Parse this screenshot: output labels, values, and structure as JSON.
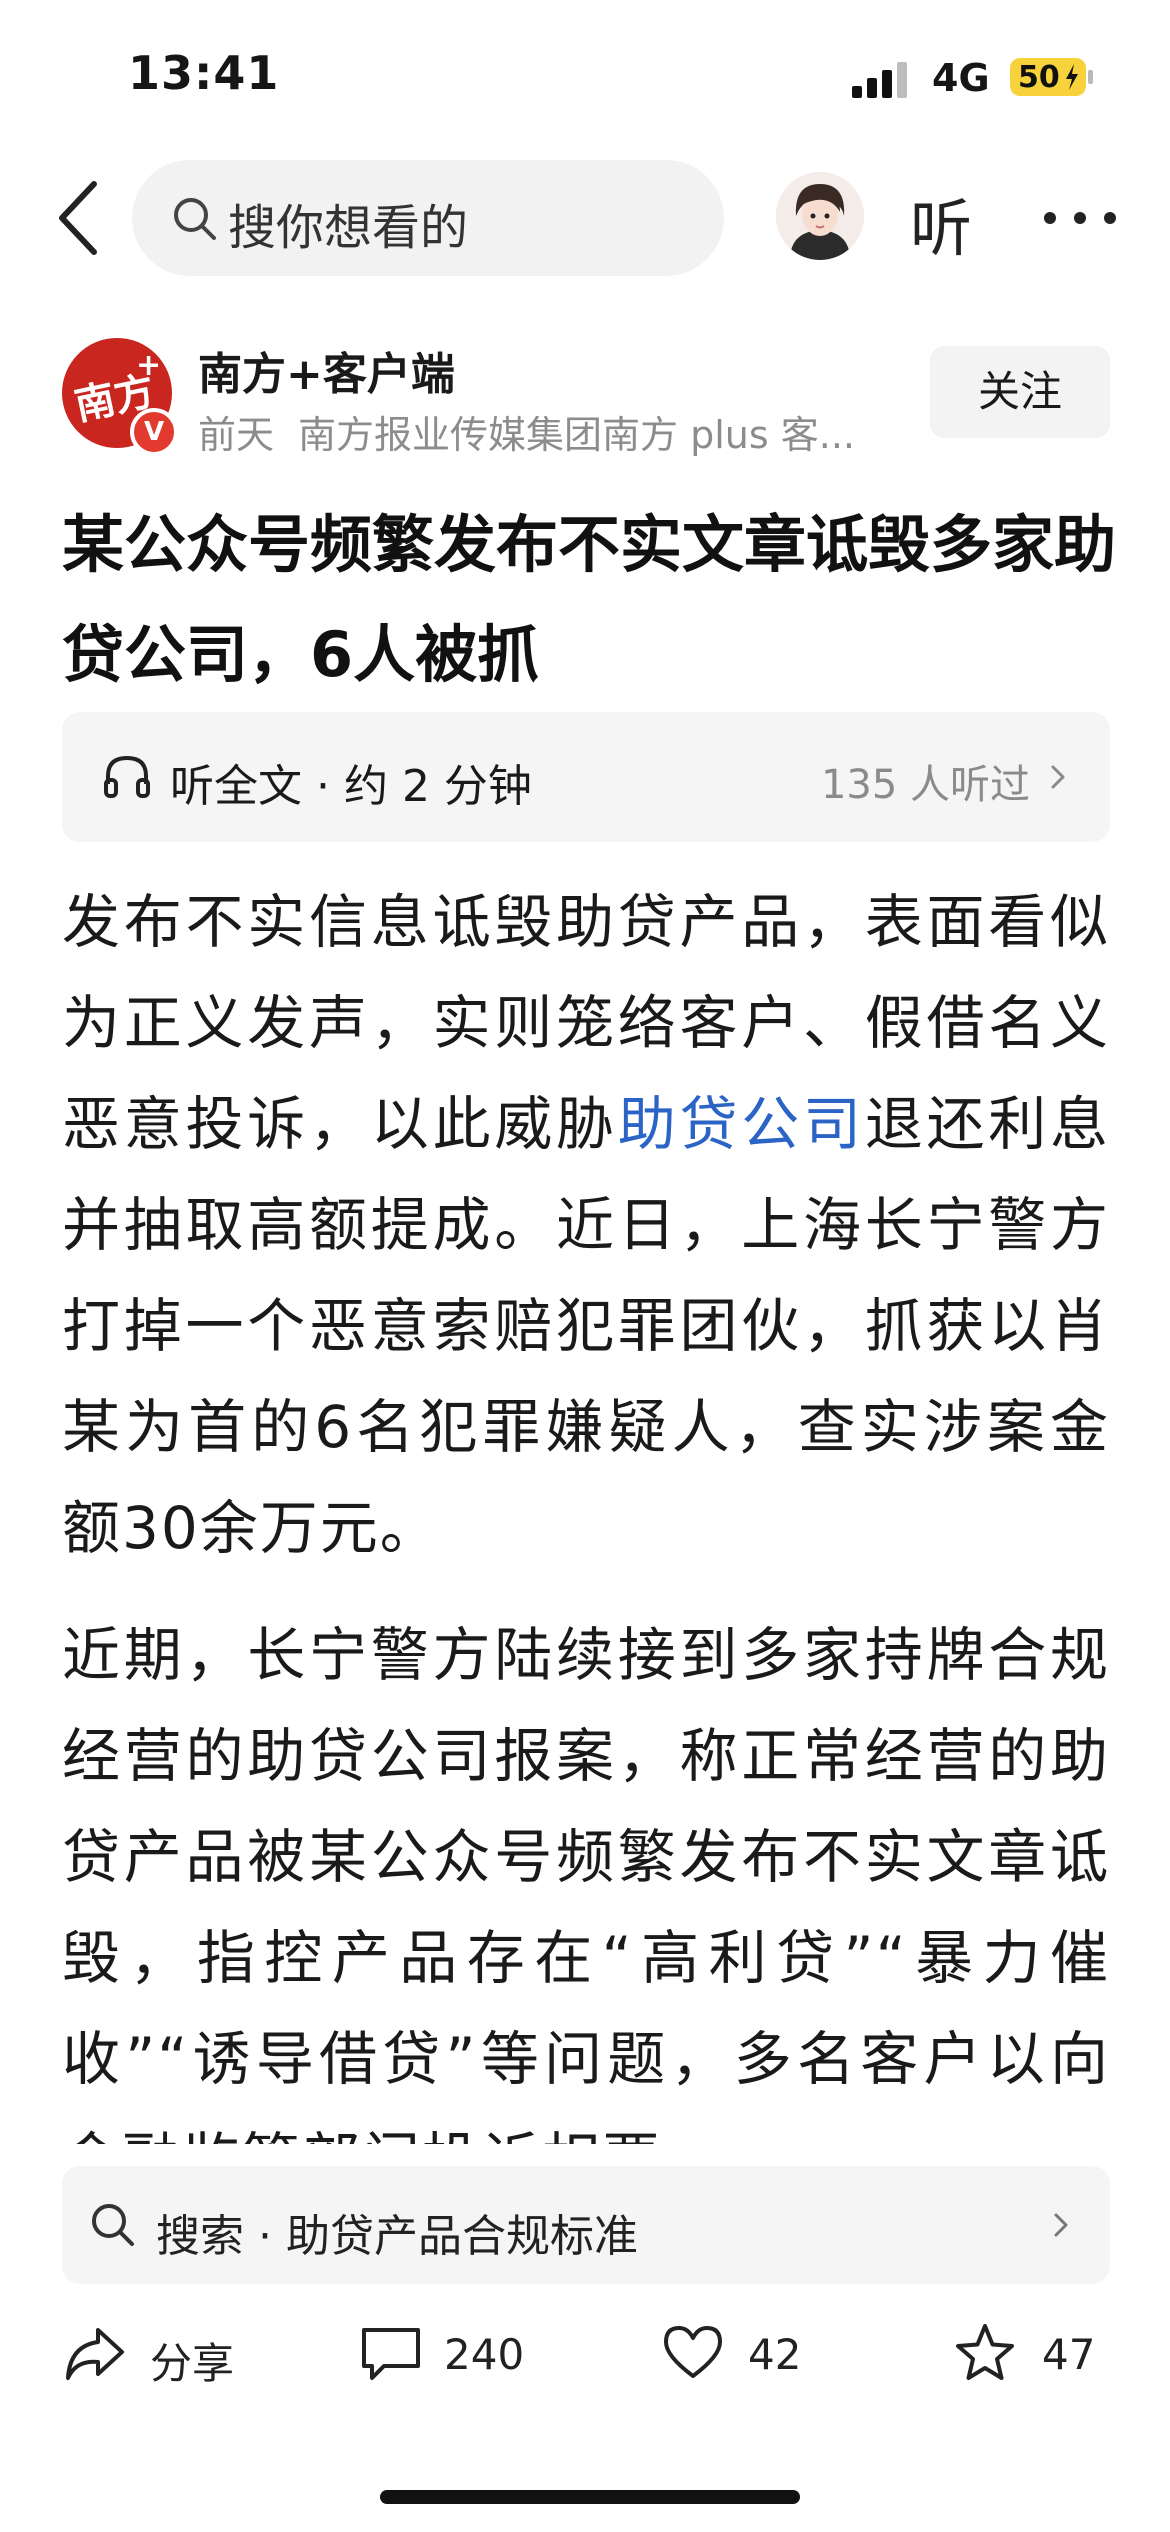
{
  "status_bar": {
    "time": "13:41",
    "network": "4G",
    "battery": "50"
  },
  "nav": {
    "search_placeholder": "搜你想看的",
    "listen_label": "听"
  },
  "author": {
    "name": "南方+客户端",
    "time": "前天",
    "source": "南方报业传媒集团南方 plus 客...",
    "follow_label": "关注",
    "logo_text": "南方",
    "badge": "V"
  },
  "article": {
    "title": "某公众号频繁发布不实文章诋毁多家助贷公司，6人被抓",
    "listen_banner": {
      "label": "听全文 · 约 2 分钟",
      "count": "135 人听过"
    },
    "paragraph1_before": "发布不实信息诋毁助贷产品，表面看似为正义发声，实则笼络客户、假借名义恶意投诉，以此威胁",
    "paragraph1_link": "助贷公司",
    "paragraph1_after": "退还利息并抽取高额提成。近日，上海长宁警方打掉一个恶意索赔犯罪团伙，抓获以肖某为首的6名犯罪嫌疑人，查实涉案金额30余万元。",
    "paragraph2": "近期，长宁警方陆续接到多家持牌合规经营的助贷公司报案，称正常经营的助贷产品被某公众号频繁发布不实文章诋毁，指控产品存在“高利贷”“暴力催收”“诱导借贷”等问题，多名客户以向金融监管部门投诉相要"
  },
  "suggestion": {
    "text": "搜索 · 助贷产品合规标准"
  },
  "actions": {
    "share": "分享",
    "comments": "240",
    "likes": "42",
    "favorites": "47"
  }
}
